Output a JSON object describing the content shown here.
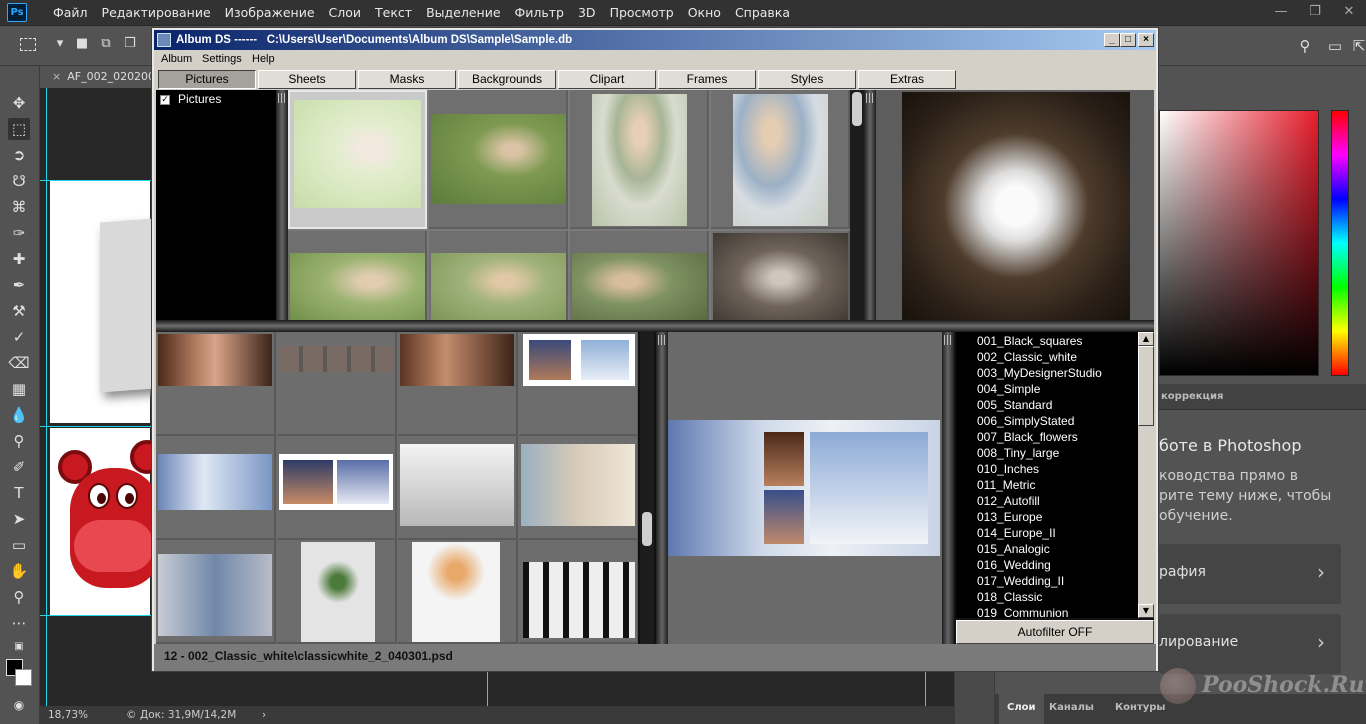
{
  "photoshop": {
    "logo": "Ps",
    "menu": [
      "Файл",
      "Редактирование",
      "Изображение",
      "Слои",
      "Текст",
      "Выделение",
      "Фильтр",
      "3D",
      "Просмотр",
      "Окно",
      "Справка"
    ],
    "document_tab": "AF_002_020200.p",
    "status": {
      "zoom": "18,73%",
      "doc": "Док: 31,9M/14,2M"
    },
    "panels": {
      "correction_tab": "коррекция",
      "learn_title": "боте в Photoshop",
      "learn_text": [
        "ководства прямо в",
        "рите тему ниже, чтобы",
        "обучение."
      ],
      "cards": [
        "рафия",
        "лирование"
      ],
      "layer_tabs": [
        "Слои",
        "Каналы",
        "Контуры"
      ]
    },
    "watermark": "PooShock.Ru",
    "colors": {
      "accent_blue": "#31a8ff",
      "guide": "#22d4e8"
    }
  },
  "album_ds": {
    "title": "Album DS ------   C:\\Users\\User\\Documents\\Album DS\\Sample\\Sample.db",
    "menu": [
      "Album",
      "Settings",
      "Help"
    ],
    "tabs": [
      "Pictures",
      "Sheets",
      "Masks",
      "Backgrounds",
      "Clipart",
      "Frames",
      "Styles",
      "Extras"
    ],
    "active_tab": "Pictures",
    "tree": {
      "label": "Pictures",
      "checked": true
    },
    "styles": [
      "001_Black_squares",
      "002_Classic_white",
      "003_MyDesignerStudio",
      "004_Simple",
      "005_Standard",
      "006_SimplyStated",
      "007_Black_flowers",
      "008_Tiny_large",
      "010_Inches",
      "011_Metric",
      "012_Autofill",
      "013_Europe",
      "014_Europe_II",
      "015_Analogic",
      "016_Wedding",
      "017_Wedding_II",
      "018_Classic",
      "019_Communion"
    ],
    "autofilter": "Autofilter OFF",
    "status": "12 - 002_Classic_white\\classicwhite_2_040301.psd"
  }
}
